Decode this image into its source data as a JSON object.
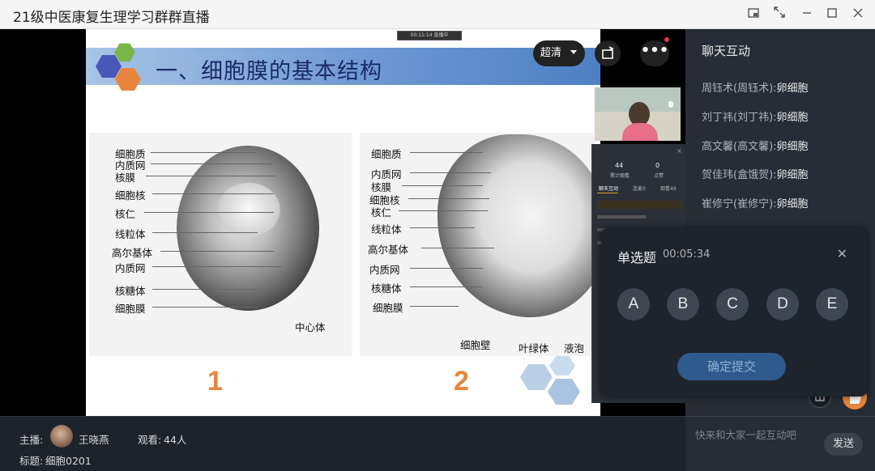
{
  "window": {
    "title": "21级中医康复生理学习群群直播"
  },
  "video": {
    "live_badge": "00:11:14 直播中",
    "quality_label": "超清",
    "slide": {
      "heading": "一、细胞膜的基本结构",
      "figure1_labels": [
        "细胞质",
        "内质网",
        "核膜",
        "细胞核",
        "核仁",
        "线粒体",
        "高尔基体",
        "内质网",
        "核糖体",
        "细胞膜",
        "中心体"
      ],
      "figure2_labels": [
        "细胞质",
        "内质网",
        "核膜",
        "细胞核",
        "核仁",
        "线粒体",
        "高尔基体",
        "内质网",
        "核糖体",
        "细胞膜",
        "细胞壁",
        "叶绿体",
        "液泡"
      ],
      "number1": "1",
      "number2": "2"
    },
    "mini_panel": {
      "stat1_value": "44",
      "stat1_label": "累计观看",
      "stat2_value": "0",
      "stat2_label": "点赞",
      "tabs": [
        "聊天互动",
        "连麦0",
        "观看49"
      ]
    }
  },
  "chat": {
    "title": "聊天互动",
    "messages": [
      {
        "user": "周钰术(周钰术):",
        "text": "卵细胞"
      },
      {
        "user": "刘丁祎(刘丁祎):",
        "text": "卵细胞"
      },
      {
        "user": "高文馨(高文馨):",
        "text": "卵细胞"
      },
      {
        "user": "贺佳玮(盒饿贺):",
        "text": "卵细胞"
      },
      {
        "user": "崔修宁(崔修宁):",
        "text": "卵细胞"
      }
    ],
    "input_placeholder": "快来和大家一起互动吧",
    "send_label": "发送"
  },
  "quiz": {
    "title": "单选题",
    "timer": "00:05:34",
    "options": [
      "A",
      "B",
      "C",
      "D",
      "E"
    ],
    "submit_label": "确定提交"
  },
  "footer": {
    "host_label": "主播:",
    "host_name": "王晓燕",
    "viewers_label": "观看:",
    "viewers_value": "44人",
    "topic_label": "标题:",
    "topic_value": "细胞0201"
  }
}
